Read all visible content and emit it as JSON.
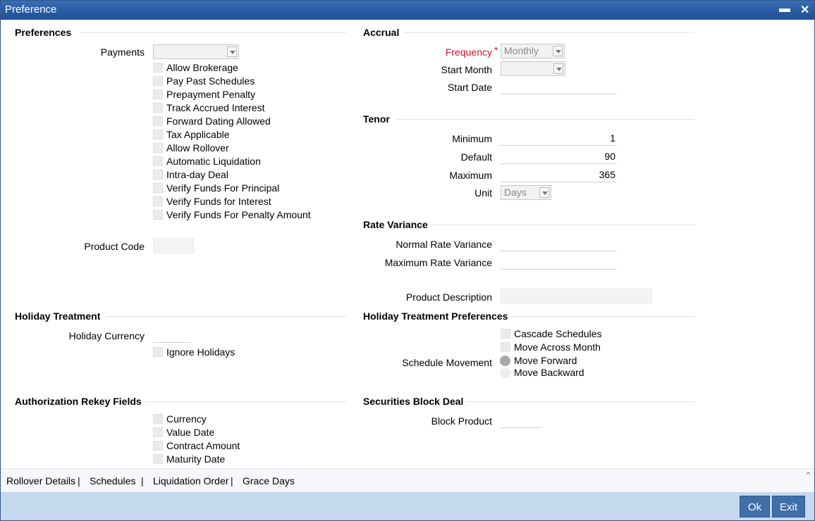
{
  "window": {
    "title": "Preference",
    "minimize": "▬",
    "close": "✕"
  },
  "preferences": {
    "heading": "Preferences",
    "payments_label": "Payments",
    "payments_value": "",
    "checkboxes": [
      "Allow Brokerage",
      "Pay Past Schedules",
      "Prepayment Penalty",
      "Track Accrued Interest",
      "Forward Dating Allowed",
      "Tax Applicable",
      "Allow Rollover",
      "Automatic Liquidation",
      "Intra-day Deal",
      "Verify Funds For Principal",
      "Verify Funds for Interest",
      "Verify Funds For Penalty Amount"
    ],
    "product_code_label": "Product Code"
  },
  "accrual": {
    "heading": "Accrual",
    "frequency_label": "Frequency",
    "required_mark": "*",
    "frequency_value": "Monthly",
    "start_month_label": "Start Month",
    "start_month_value": "",
    "start_date_label": "Start Date",
    "start_date_value": ""
  },
  "tenor": {
    "heading": "Tenor",
    "minimum_label": "Minimum",
    "minimum_value": "1",
    "default_label": "Default",
    "default_value": "90",
    "maximum_label": "Maximum",
    "maximum_value": "365",
    "unit_label": "Unit",
    "unit_value": "Days"
  },
  "rate_variance": {
    "heading": "Rate Variance",
    "normal_label": "Normal Rate Variance",
    "normal_value": "",
    "maximum_label": "Maximum Rate Variance",
    "maximum_value": "",
    "product_description_label": "Product Description"
  },
  "holiday_treatment": {
    "heading": "Holiday Treatment",
    "currency_label": "Holiday Currency",
    "ignore_holidays": "Ignore Holidays"
  },
  "holiday_prefs": {
    "heading": "Holiday Treatment Preferences",
    "cascade": "Cascade Schedules",
    "move_across": "Move Across Month",
    "schedule_movement_label": "Schedule Movement",
    "move_forward": "Move Forward",
    "move_backward": "Move Backward"
  },
  "auth_rekey": {
    "heading": "Authorization Rekey Fields",
    "checkboxes": [
      "Currency",
      "Value Date",
      "Contract Amount",
      "Maturity Date"
    ]
  },
  "securities": {
    "heading": "Securities Block Deal",
    "block_product_label": "Block Product"
  },
  "tabs": [
    "Rollover Details",
    "Schedules",
    "Liquidation Order",
    "Grace Days"
  ],
  "tab_separator": "|",
  "footer": {
    "ok": "Ok",
    "exit": "Exit"
  },
  "colors": {
    "title_bar": "#2a5ea5",
    "footer": "#c4d9ee",
    "button": "#3f6ea8",
    "required": "#c8102e"
  }
}
